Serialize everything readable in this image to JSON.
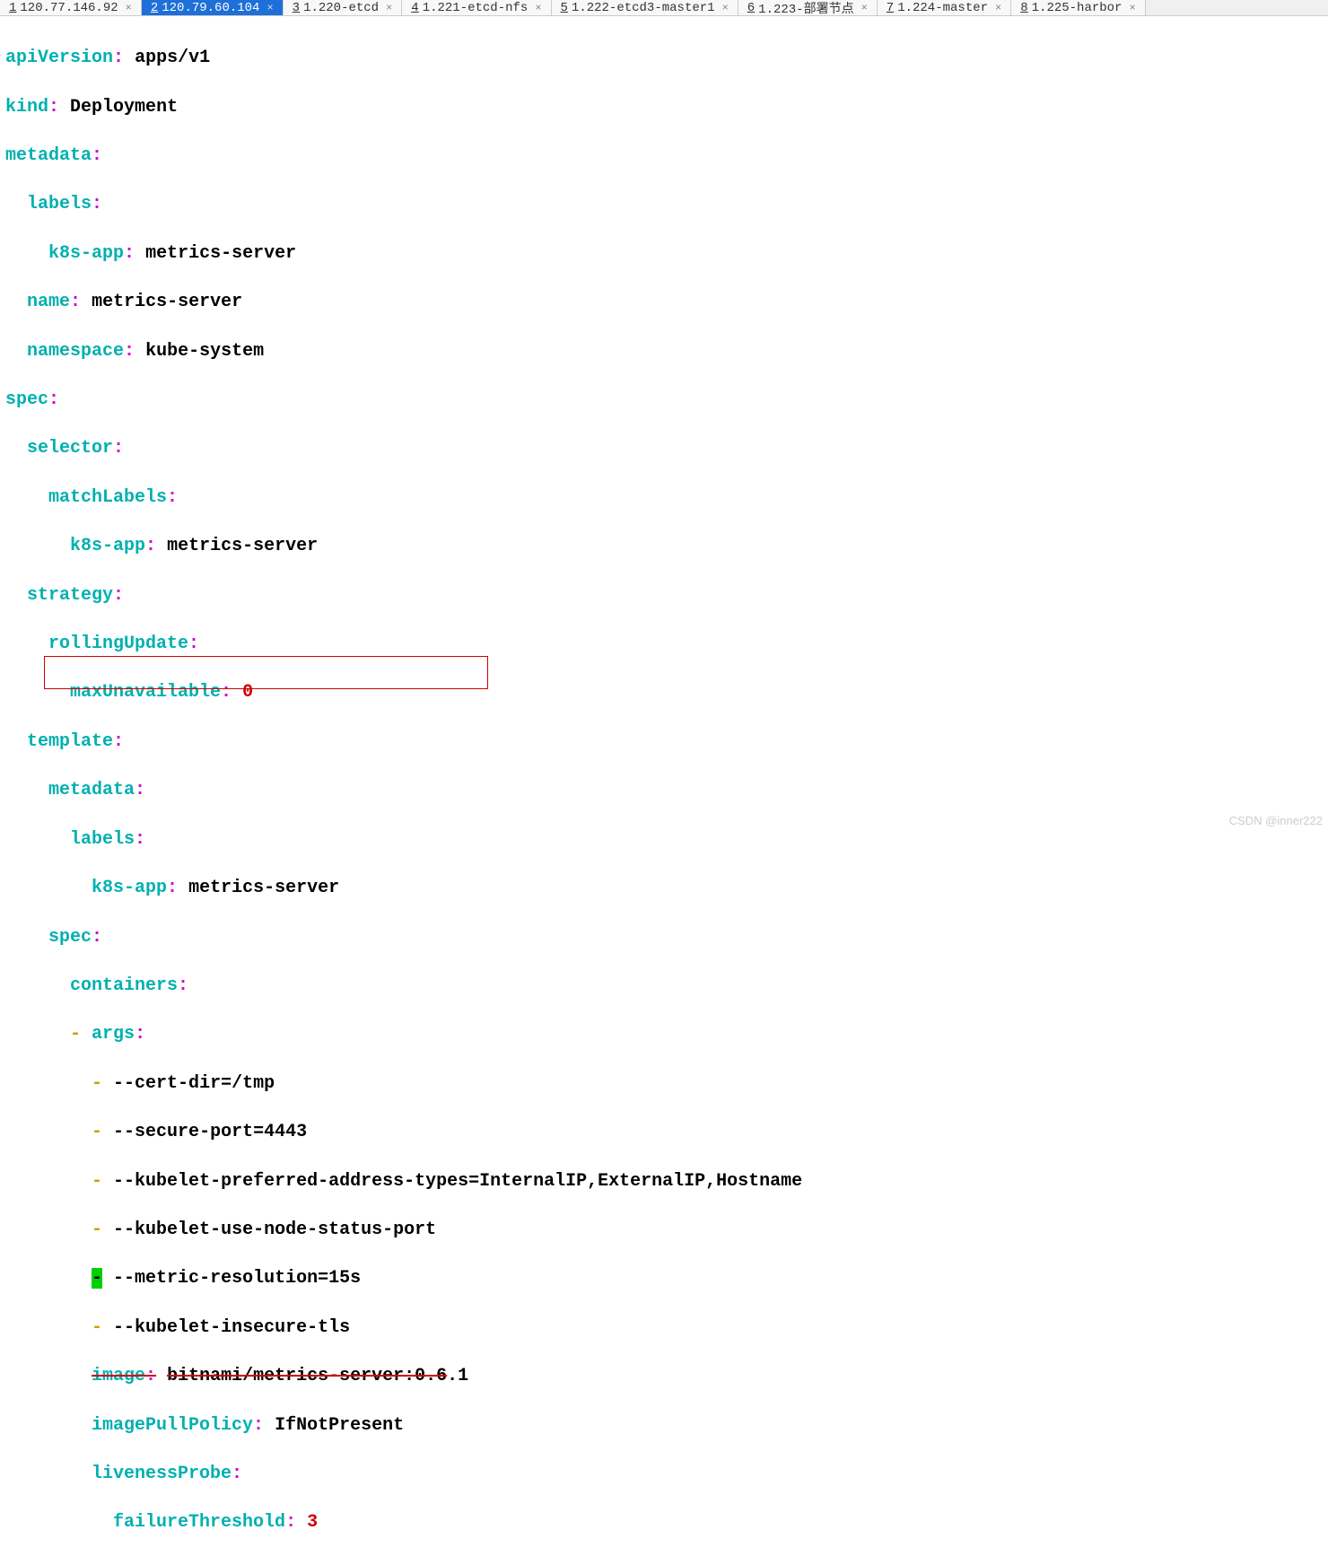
{
  "tabs": [
    {
      "num": "1",
      "label": "120.77.146.92",
      "active": false
    },
    {
      "num": "2",
      "label": "120.79.60.104",
      "active": true
    },
    {
      "num": "3",
      "label": "1.220-etcd",
      "active": false
    },
    {
      "num": "4",
      "label": "1.221-etcd-nfs",
      "active": false
    },
    {
      "num": "5",
      "label": "1.222-etcd3-master1",
      "active": false
    },
    {
      "num": "6",
      "label": "1.223-部署节点",
      "active": false
    },
    {
      "num": "7",
      "label": "1.224-master",
      "active": false
    },
    {
      "num": "8",
      "label": "1.225-harbor",
      "active": false
    }
  ],
  "yaml": {
    "l1_key": "apiVersion",
    "l1_val": "apps/v1",
    "l2_key": "kind",
    "l2_val": "Deployment",
    "l3_key": "metadata",
    "l4_key": "labels",
    "l5_key": "k8s-app",
    "l5_val": "metrics-server",
    "l6_key": "name",
    "l6_val": "metrics-server",
    "l7_key": "namespace",
    "l7_val": "kube-system",
    "l8_key": "spec",
    "l9_key": "selector",
    "l10_key": "matchLabels",
    "l11_key": "k8s-app",
    "l11_val": "metrics-server",
    "l12_key": "strategy",
    "l13_key": "rollingUpdate",
    "l14_key": "maxUnavailable",
    "l14_val": "0",
    "l15_key": "template",
    "l16_key": "metadata",
    "l17_key": "labels",
    "l18_key": "k8s-app",
    "l18_val": "metrics-server",
    "l19_key": "spec",
    "l20_key": "containers",
    "l21_key": "args",
    "l22_val": "--cert-dir=/tmp",
    "l23_val": "--secure-port=4443",
    "l24_val": "--kubelet-preferred-address-types=InternalIP,ExternalIP,Hostname",
    "l25_val": "--kubelet-use-node-status-port",
    "l26_val": "--metric-resolution=15s",
    "l27_val": "--kubelet-insecure-tls",
    "l28_key": "image",
    "l28_val": "bitnami/metrics-server:0.6.1",
    "l29_key": "imagePullPolicy",
    "l29_val": "IfNotPresent",
    "l30_key": "livenessProbe",
    "l31_key": "failureThreshold",
    "l31_val": "3"
  },
  "watermark": "CSDN @inner222"
}
